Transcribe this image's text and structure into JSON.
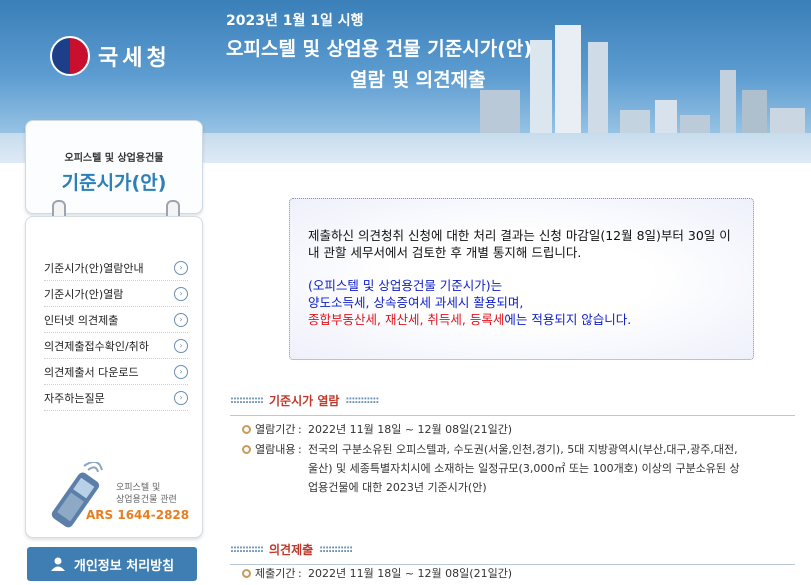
{
  "banner": {
    "logo_text": "국세청",
    "date": "2023년 1월 1일 시행",
    "title_line1": "오피스텔 및 상업용 건물 기준시가(안)",
    "title_line2": "열람 및 의견제출"
  },
  "sidebar": {
    "card_sub": "오피스텔 및 상업용건물",
    "card_title": "기준시가(안)",
    "items": [
      {
        "label": "기준시가(안)열람안내"
      },
      {
        "label": "기준시가(안)열람"
      },
      {
        "label": "인터넷 의견제출"
      },
      {
        "label": "의견제출접수확인/취하"
      },
      {
        "label": "의견제출서 다운로드"
      },
      {
        "label": "자주하는질문"
      }
    ],
    "ars_label1": "오피스텔 및",
    "ars_label2": "상업용건물 관련",
    "ars_number": "ARS  1644-2828",
    "privacy_button": "개인정보 처리방침"
  },
  "notice": {
    "line1": "제출하신 의견청취 신청에 대한 처리 결과는 신청 마감일(12월 8일)부터 30일 이내 관할 세무서에서 검토한 후 개별 통지해 드립니다.",
    "line2": "(오피스텔 및 상업용건물 기준시가)는",
    "line3": "양도소득세, 상속증여세 과세시 활용되며,",
    "line4_red": "종합부동산세, 재산세, 취득세, 등록세",
    "line4_blue": "에는 적용되지 않습니다."
  },
  "section1": {
    "title": "기준시가 열람",
    "period_key": "열람기간",
    "period_val": "2022년 11월 18일 ~ 12월 08일(21일간)",
    "content_key": "열람내용",
    "content_val": "전국의 구분소유된 오피스텔과, 수도권(서울,인천,경기), 5대 지방광역시(부산,대구,광주,대전,울산) 및 세종특별자치시에 소재하는 일정규모(3,000㎡ 또는 100개호) 이상의 구분소유된 상업용건물에 대한 2023년 기준시가(안)"
  },
  "section2": {
    "title": "의견제출",
    "period_key": "제출기간",
    "period_val": "2022년 11월 18일 ~ 12월 08일(21일간)"
  }
}
